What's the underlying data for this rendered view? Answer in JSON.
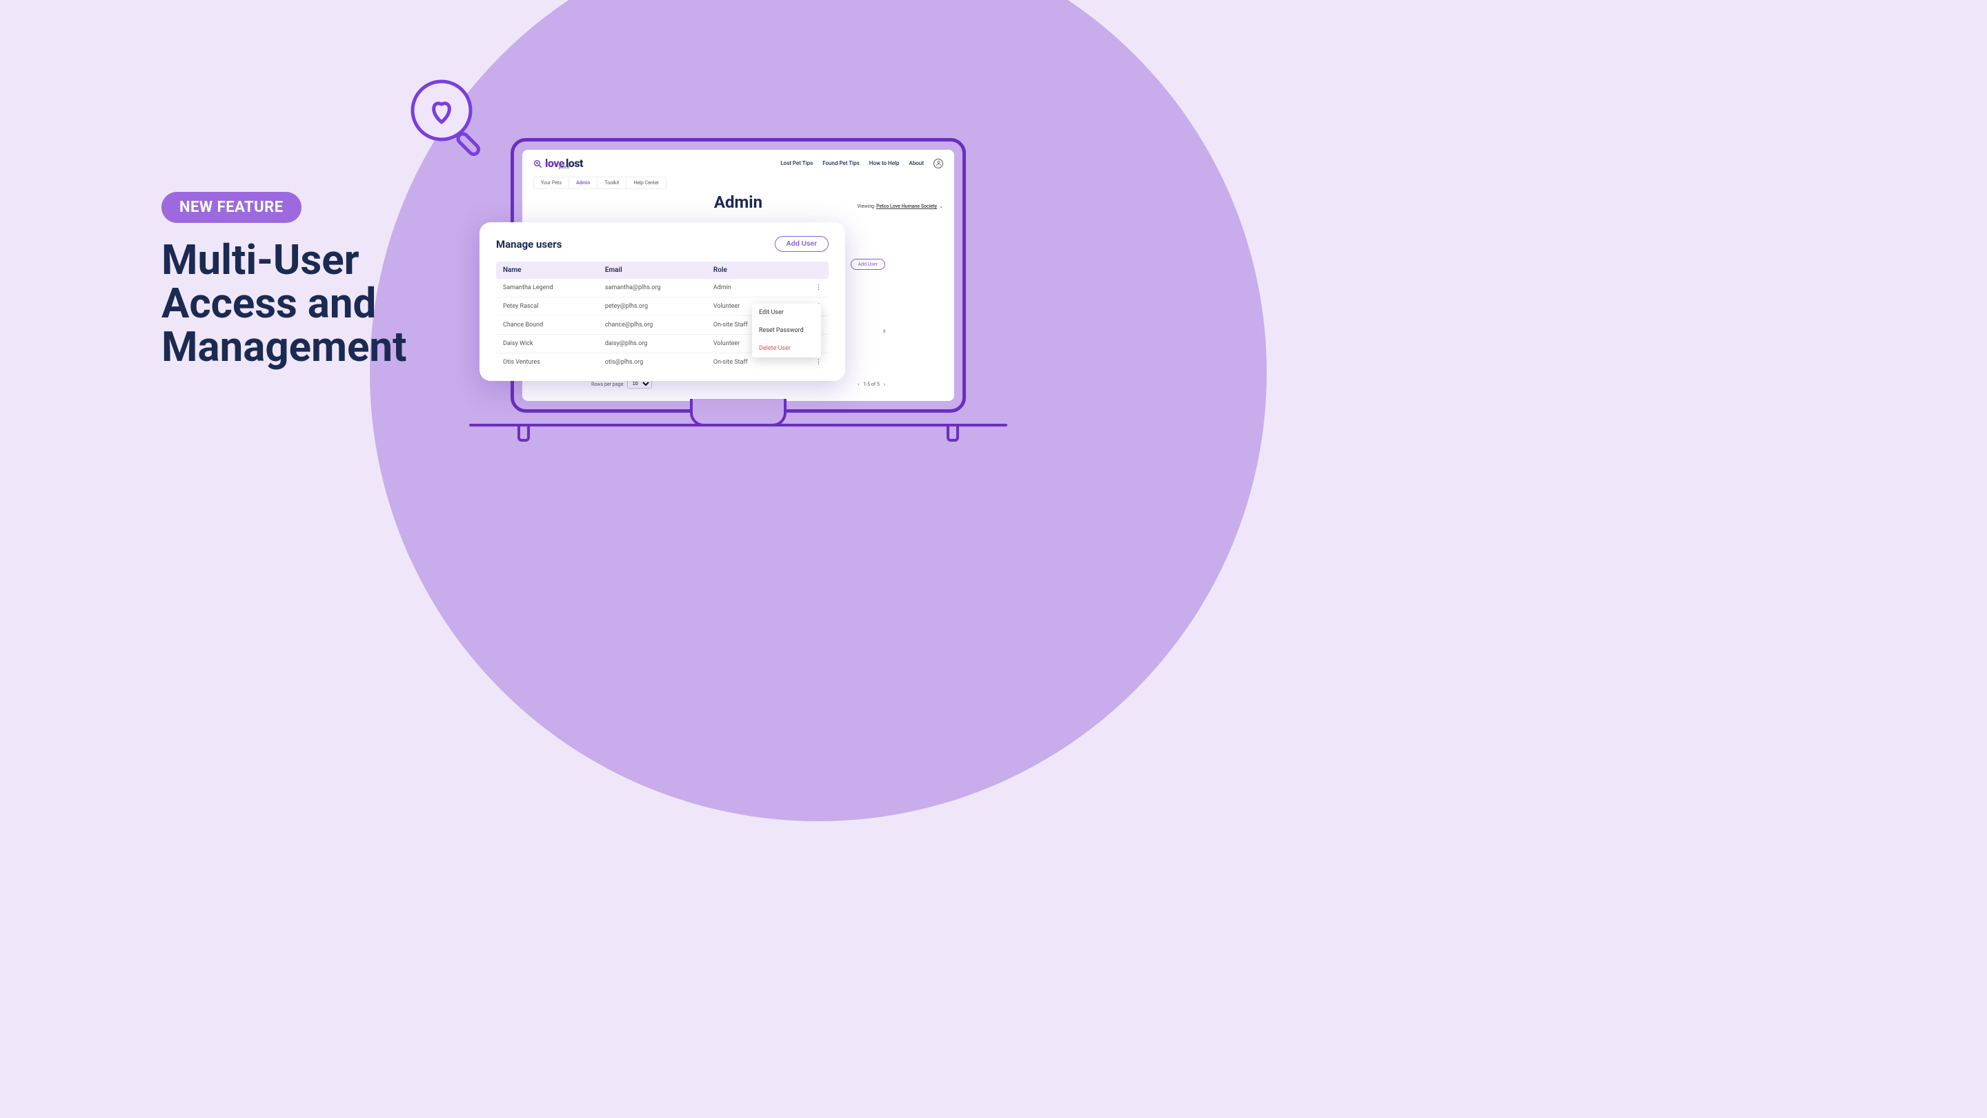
{
  "promo": {
    "badge": "NEW FEATURE",
    "headline_l1": "Multi-User",
    "headline_l2": "Access and",
    "headline_l3": "Management"
  },
  "logo": {
    "petco": "petco",
    "love": "love",
    "lost": "lost"
  },
  "nav": {
    "items": [
      "Lost Pet Tips",
      "Found Pet Tips",
      "How to Help",
      "About"
    ]
  },
  "subtabs": {
    "items": [
      "Your Pets",
      "Admin",
      "Toolkit",
      "Help Center"
    ],
    "active_index": 1
  },
  "page_title": "Admin",
  "viewing": {
    "prefix": "Viewing",
    "org": "Petco Love Humane Society"
  },
  "card": {
    "title": "Manage users",
    "add_label": "Add User",
    "columns": {
      "name": "Name",
      "email": "Email",
      "role": "Role"
    },
    "rows": [
      {
        "name": "Samantha Legend",
        "email": "samantha@plhs.org",
        "role": "Admin"
      },
      {
        "name": "Petey Rascal",
        "email": "petey@plhs.org",
        "role": "Volunteer"
      },
      {
        "name": "Chance Bound",
        "email": "chance@plhs.org",
        "role": "On-site Staff"
      },
      {
        "name": "Daisy Wick",
        "email": "daisy@plhs.org",
        "role": "Volunteer"
      },
      {
        "name": "Otis Ventures",
        "email": "otis@plhs.org",
        "role": "On-site Staff"
      }
    ]
  },
  "menu": {
    "edit": "Edit User",
    "reset": "Reset Password",
    "delete": "Delete User"
  },
  "shadow": {
    "add_label": "Add User"
  },
  "pager": {
    "rpp_label": "Rows per page:",
    "rpp_value": "10",
    "range": "1-5 of 5"
  }
}
